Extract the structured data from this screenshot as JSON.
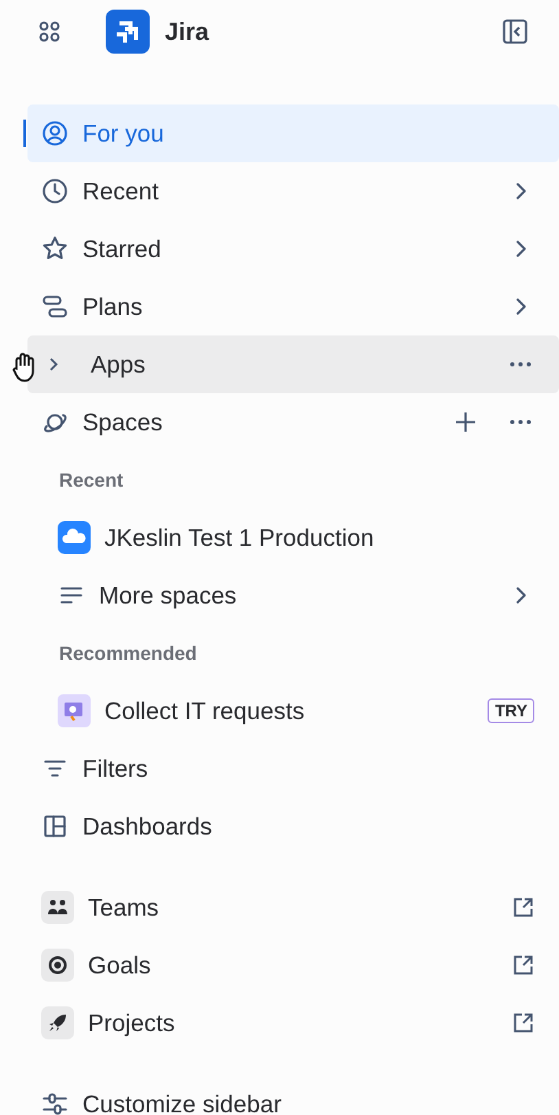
{
  "header": {
    "title": "Jira"
  },
  "items": [
    {
      "kind": "nav",
      "label": "For you",
      "selected": true,
      "hovered": false,
      "chevron": false,
      "more": false,
      "add": false
    },
    {
      "kind": "nav",
      "label": "Recent",
      "selected": false,
      "hovered": false,
      "chevron": true,
      "more": false,
      "add": false
    },
    {
      "kind": "nav",
      "label": "Starred",
      "selected": false,
      "hovered": false,
      "chevron": true,
      "more": false,
      "add": false
    },
    {
      "kind": "nav",
      "label": "Plans",
      "selected": false,
      "hovered": false,
      "chevron": true,
      "more": false,
      "add": false
    },
    {
      "kind": "nav",
      "label": "Apps",
      "selected": false,
      "hovered": true,
      "expanded": false,
      "chevron": false,
      "more": true,
      "add": false
    },
    {
      "kind": "nav",
      "label": "Spaces",
      "selected": false,
      "hovered": false,
      "chevron": false,
      "more": true,
      "add": true
    },
    {
      "kind": "heading",
      "label": "Recent"
    },
    {
      "kind": "space",
      "label": "JKeslin Test 1 Production",
      "chevron": false
    },
    {
      "kind": "space",
      "label": "More spaces",
      "chevron": true
    },
    {
      "kind": "heading",
      "label": "Recommended"
    },
    {
      "kind": "space",
      "label": "Collect IT requests",
      "badge": "TRY"
    },
    {
      "kind": "nav",
      "label": "Filters",
      "selected": false,
      "hovered": false,
      "chevron": false,
      "more": false,
      "add": false
    },
    {
      "kind": "nav",
      "label": "Dashboards",
      "selected": false,
      "hovered": false,
      "chevron": false,
      "more": false,
      "add": false
    },
    {
      "kind": "gap"
    },
    {
      "kind": "external",
      "label": "Teams"
    },
    {
      "kind": "external",
      "label": "Goals"
    },
    {
      "kind": "external",
      "label": "Projects"
    },
    {
      "kind": "gap"
    },
    {
      "kind": "nav",
      "label": "Customize sidebar",
      "selected": false,
      "hovered": false,
      "chevron": false,
      "more": false,
      "add": false
    }
  ]
}
